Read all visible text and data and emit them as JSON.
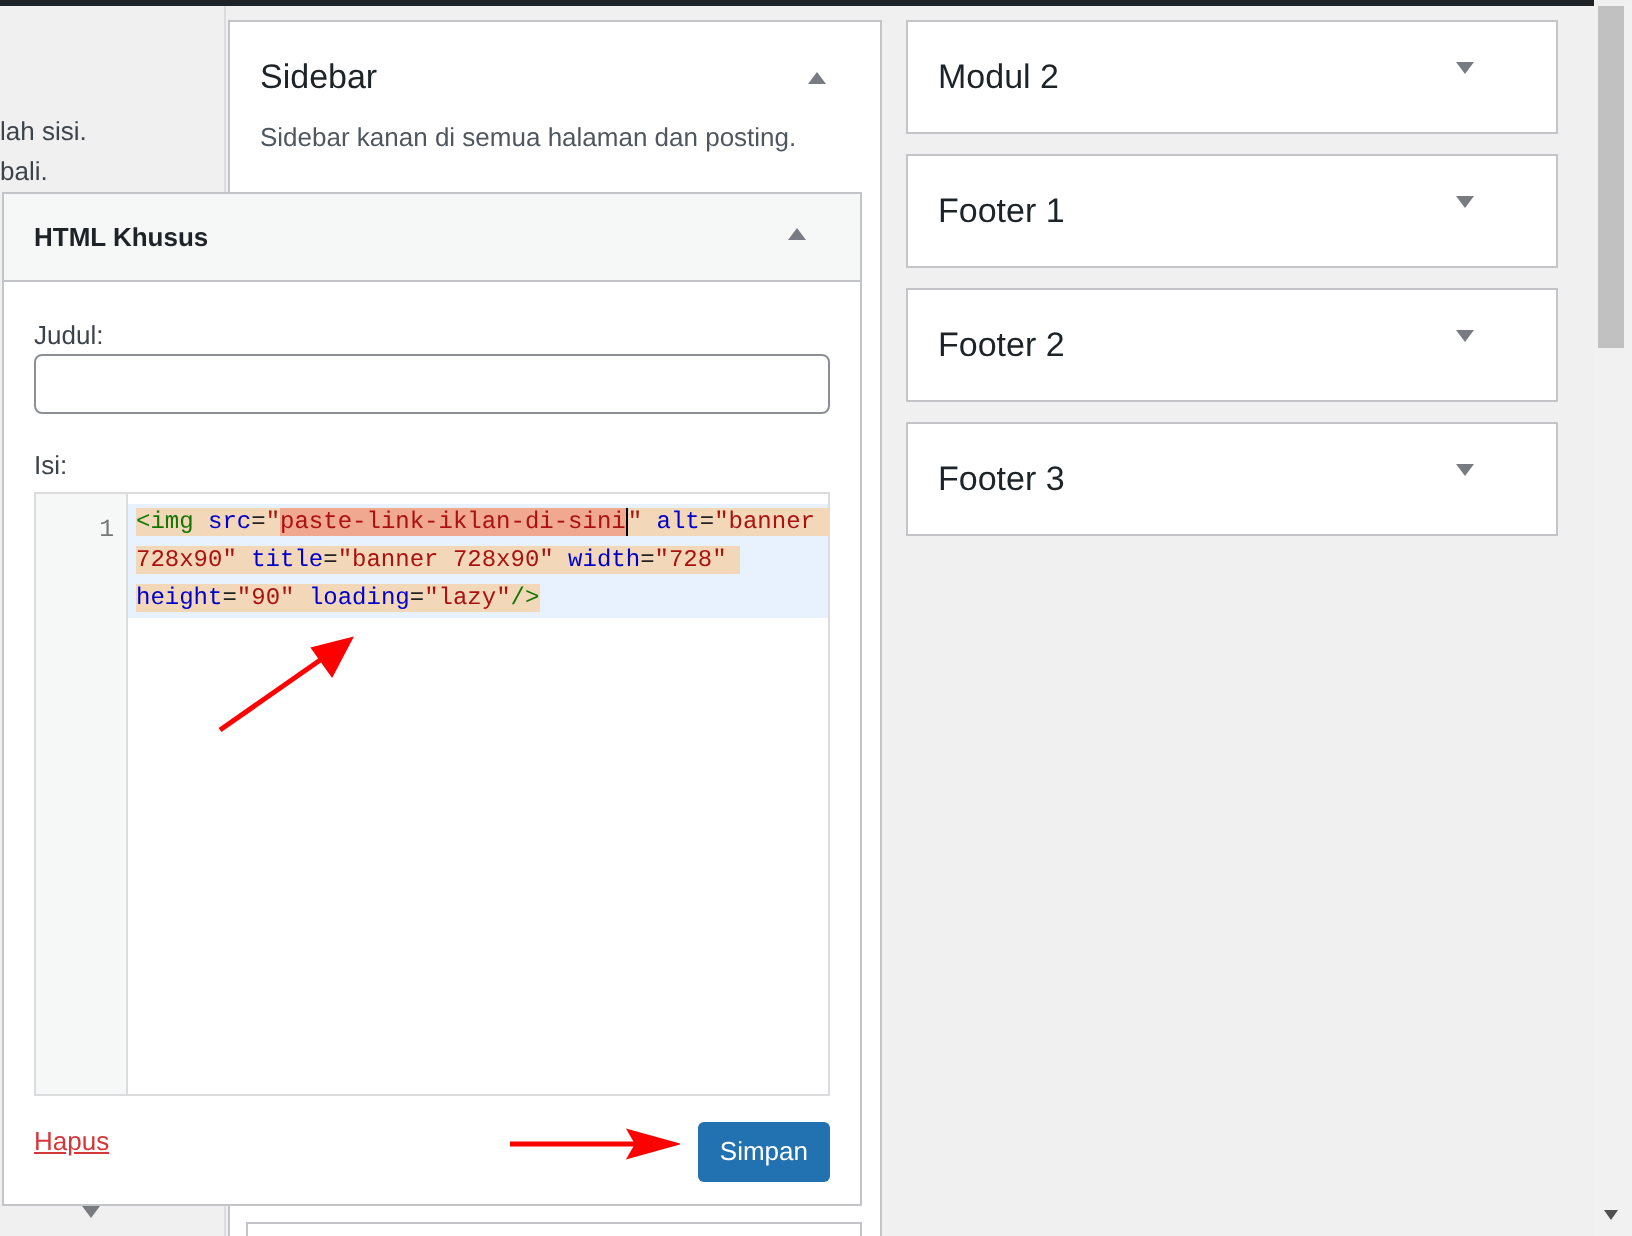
{
  "left_notes": [
    "lah sisi.",
    "bali."
  ],
  "left_panel": {
    "expanded": false
  },
  "sidebar_area": {
    "title": "Sidebar",
    "description": "Sidebar kanan di semua halaman dan posting.",
    "expanded": true
  },
  "widget": {
    "title": "HTML Khusus",
    "expanded": true,
    "title_field": {
      "label": "Judul:"
    },
    "content_field": {
      "label": "Isi:",
      "line_number": "1",
      "tokens": [
        {
          "kind": "tag",
          "text": "<img "
        },
        {
          "kind": "attr",
          "text": "src"
        },
        {
          "kind": "punct",
          "text": "="
        },
        {
          "kind": "string",
          "text": "\""
        },
        {
          "kind": "marked",
          "text": "paste-link-iklan-di-sini"
        },
        {
          "kind": "string",
          "text": "\" "
        },
        {
          "kind": "attr",
          "text": "alt"
        },
        {
          "kind": "punct",
          "text": "="
        },
        {
          "kind": "string",
          "text": "\"banner 728x90\" "
        },
        {
          "kind": "attr",
          "text": "title"
        },
        {
          "kind": "punct",
          "text": "="
        },
        {
          "kind": "string",
          "text": "\"banner 728x90\" "
        },
        {
          "kind": "attr",
          "text": "width"
        },
        {
          "kind": "punct",
          "text": "="
        },
        {
          "kind": "string",
          "text": "\"728\" "
        },
        {
          "kind": "attr",
          "text": "height"
        },
        {
          "kind": "punct",
          "text": "="
        },
        {
          "kind": "string",
          "text": "\"90\" "
        },
        {
          "kind": "attr",
          "text": "loading"
        },
        {
          "kind": "punct",
          "text": "="
        },
        {
          "kind": "string",
          "text": "\"lazy\""
        },
        {
          "kind": "tag",
          "text": "/>"
        }
      ]
    },
    "delete_link": "Hapus",
    "save_button": "Simpan"
  },
  "areas": [
    {
      "title": "Modul 2",
      "expanded": false
    },
    {
      "title": "Footer 1",
      "expanded": false
    },
    {
      "title": "Footer 2",
      "expanded": false
    },
    {
      "title": "Footer 3",
      "expanded": false
    }
  ]
}
